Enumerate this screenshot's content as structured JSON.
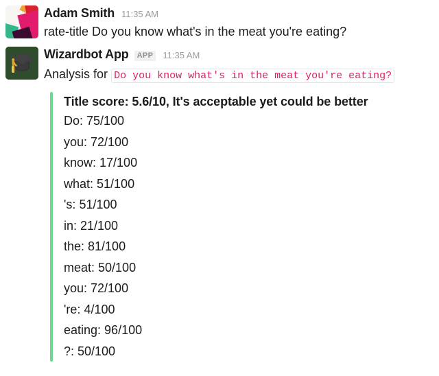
{
  "messages": [
    {
      "sender": "Adam Smith",
      "timestamp": "11:35 AM",
      "badge": null,
      "text": "rate-title Do you know what's in the meat you're eating?",
      "avatar_name": "adam-smith-avatar"
    },
    {
      "sender": "Wizardbot App",
      "timestamp": "11:35 AM",
      "badge": "APP",
      "text_prefix": "Analysis for",
      "code_snippet": "Do you know what's in the meat you're eating?",
      "avatar_name": "wizardbot-app-avatar"
    }
  ],
  "attachment": {
    "bar_color": "#6fd694",
    "title": "Title score: 5.6/10, It's acceptable yet could be better",
    "scores": [
      {
        "label": "Do",
        "value": "75/100",
        "line": "Do: 75/100"
      },
      {
        "label": "you",
        "value": "72/100",
        "line": "you: 72/100"
      },
      {
        "label": "know",
        "value": "17/100",
        "line": "know: 17/100"
      },
      {
        "label": "what",
        "value": "51/100",
        "line": "what: 51/100"
      },
      {
        "label": "'s",
        "value": "51/100",
        "line": "'s: 51/100"
      },
      {
        "label": "in",
        "value": "21/100",
        "line": "in: 21/100"
      },
      {
        "label": "the",
        "value": "81/100",
        "line": "the: 81/100"
      },
      {
        "label": "meat",
        "value": "50/100",
        "line": "meat: 50/100"
      },
      {
        "label": "you",
        "value": "72/100",
        "line": "you: 72/100"
      },
      {
        "label": "'re",
        "value": "4/100",
        "line": "'re: 4/100"
      },
      {
        "label": "eating",
        "value": "96/100",
        "line": "eating: 96/100"
      },
      {
        "label": "?",
        "value": "50/100",
        "line": "?: 50/100"
      }
    ]
  },
  "colors": {
    "accent_green": "#6fd694",
    "code_red": "#e01e5a",
    "text": "#1d1c1d",
    "muted": "#9b9b9b",
    "badge_bg": "#f0f0f0"
  }
}
